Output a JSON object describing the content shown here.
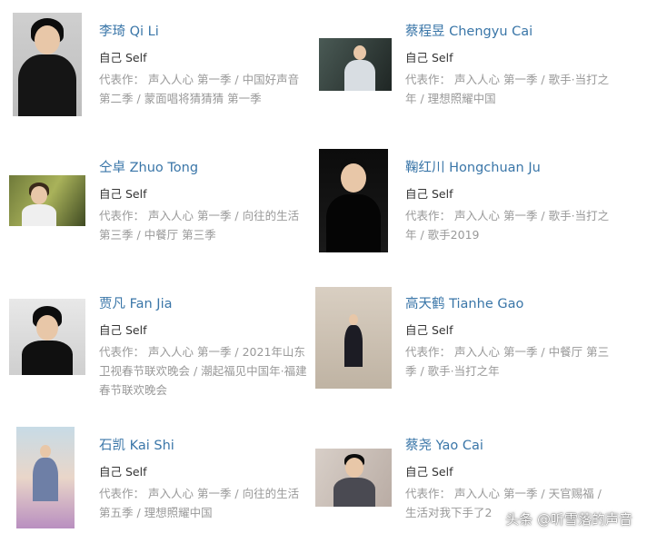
{
  "cast": [
    {
      "name": "李琦 Qi Li",
      "role": "自己 Self",
      "works": "代表作： 声入人心 第一季 / 中国好声音 第二季 / 蒙面唱将猜猜猜 第一季",
      "photo": "photo-qi-li"
    },
    {
      "name": "蔡程昱 Chengyu Cai",
      "role": "自己 Self",
      "works": "代表作： 声入人心 第一季 / 歌手·当打之年 / 理想照耀中国",
      "photo": "photo-chengyu-cai"
    },
    {
      "name": "仝卓 Zhuo Tong",
      "role": "自己 Self",
      "works": "代表作： 声入人心 第一季 / 向往的生活 第三季 / 中餐厅 第三季",
      "photo": "photo-zhuo-tong"
    },
    {
      "name": "鞠红川 Hongchuan Ju",
      "role": "自己 Self",
      "works": "代表作： 声入人心 第一季 / 歌手·当打之年 / 歌手2019",
      "photo": "photo-hongchuan-ju"
    },
    {
      "name": "贾凡 Fan Jia",
      "role": "自己 Self",
      "works": "代表作： 声入人心 第一季 / 2021年山东卫视春节联欢晚会 / 潮起福见中国年·福建春节联欢晚会",
      "photo": "photo-fan-jia"
    },
    {
      "name": "高天鹤 Tianhe Gao",
      "role": "自己 Self",
      "works": "代表作： 声入人心 第一季 / 中餐厅 第三季 / 歌手·当打之年",
      "photo": "photo-tianhe-gao"
    },
    {
      "name": "石凯 Kai Shi",
      "role": "自己 Self",
      "works": "代表作： 声入人心 第一季 / 向往的生活 第五季 / 理想照耀中国",
      "photo": "photo-kai-shi"
    },
    {
      "name": "蔡尧 Yao Cai",
      "role": "自己 Self",
      "works": "代表作： 声入人心 第一季 / 天官赐福 / 生活对我下手了2",
      "photo": "photo-yao-cai"
    }
  ],
  "watermark": "头条 @听雪落的声音"
}
